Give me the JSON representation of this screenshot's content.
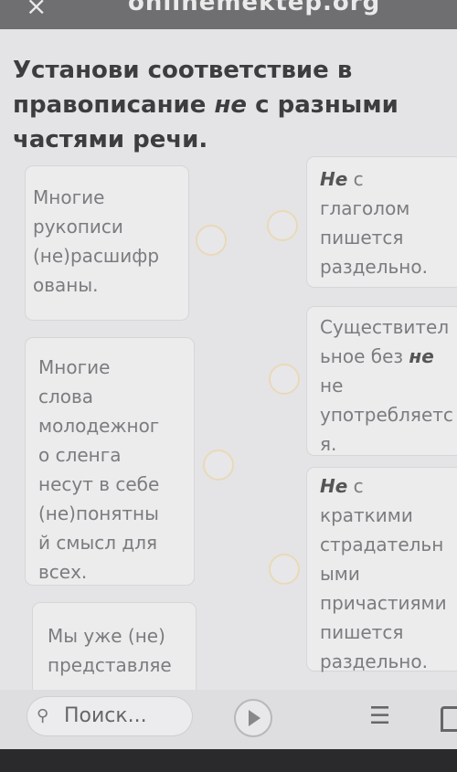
{
  "top_bar": {
    "site_name": "onlinemektep.org"
  },
  "question": {
    "line1": "Установи соответствие в",
    "line2_prefix": "правописание ",
    "line2_em": "не",
    "line2_suffix": " с разными",
    "line3": "частями речи."
  },
  "left_items": [
    {
      "lines": [
        "Многие",
        "рукописи",
        "(не)расшифр",
        "ованы."
      ]
    },
    {
      "lines": [
        "Многие",
        "слова",
        "молодежног",
        "о сленга",
        "несут в себе",
        "(не)понятны",
        "й смысл для",
        "всех."
      ]
    },
    {
      "lines": [
        "Мы уже (не)",
        "представляе"
      ]
    }
  ],
  "right_items": [
    {
      "line1_em": "Не",
      "line1_rest": " с",
      "lines": [
        "глаголом",
        "пишется",
        "раздельно."
      ]
    },
    {
      "line1": "Существител",
      "line2_pre": "ьное без ",
      "line2_em": "не",
      "lines": [
        "не",
        "употребляетс",
        "я."
      ]
    },
    {
      "line1_em": "Не",
      "line1_rest": " с",
      "lines": [
        "краткими",
        "страдательн",
        "ыми",
        "причастиями",
        "пишется",
        "раздельно."
      ]
    }
  ],
  "bottom_bar": {
    "search_placeholder": "Поиск..."
  },
  "icons": [
    "close-icon",
    "search-icon",
    "play-icon",
    "list-icon",
    "home-icon"
  ]
}
